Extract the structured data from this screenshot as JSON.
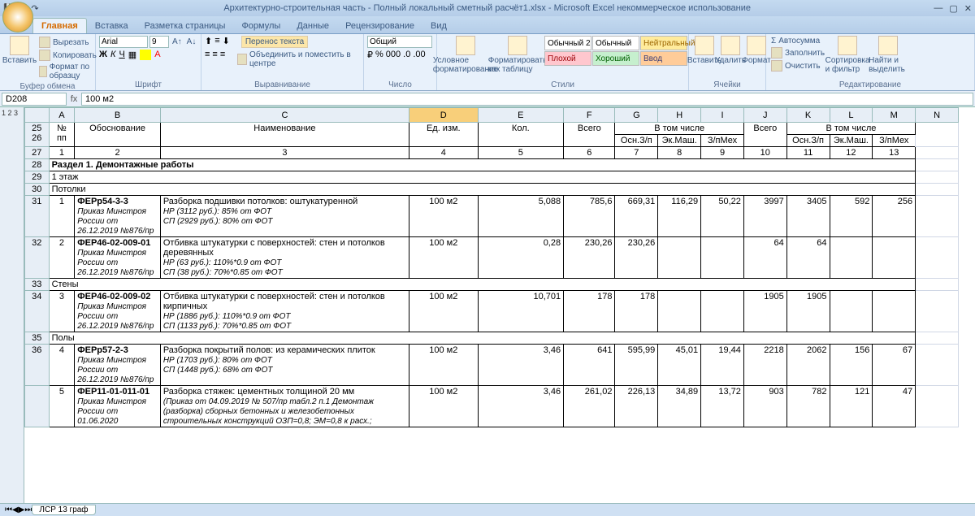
{
  "title": "Архитектурно-строительная часть - Полный локальный сметный расчёт1.xlsx - Microsoft Excel некоммерческое использование",
  "tabs": [
    "Главная",
    "Вставка",
    "Разметка страницы",
    "Формулы",
    "Данные",
    "Рецензирование",
    "Вид"
  ],
  "ribbon": {
    "clipboard": {
      "paste": "Вставить",
      "cut": "Вырезать",
      "copy": "Копировать",
      "fmt": "Формат по образцу",
      "label": "Буфер обмена"
    },
    "font": {
      "name": "Arial",
      "size": "9",
      "label": "Шрифт"
    },
    "align": {
      "wrap": "Перенос текста",
      "merge": "Объединить и поместить в центре",
      "label": "Выравнивание"
    },
    "number": {
      "fmt": "Общий",
      "label": "Число"
    },
    "styles": {
      "cond": "Условное форматирование",
      "table": "Форматировать как таблицу",
      "s1": "Обычный 2",
      "s2": "Обычный",
      "s3": "Нейтральный",
      "s4": "Плохой",
      "s5": "Хороший",
      "s6": "Ввод",
      "label": "Стили"
    },
    "cells": {
      "ins": "Вставить",
      "del": "Удалить",
      "fmt": "Формат",
      "label": "Ячейки"
    },
    "edit": {
      "sum": "Автосумма",
      "fill": "Заполнить",
      "clear": "Очистить",
      "sort": "Сортировка и фильтр",
      "find": "Найти и выделить",
      "label": "Редактирование"
    }
  },
  "namebox": "D208",
  "formula": "100 м2",
  "cols": [
    "A",
    "B",
    "C",
    "D",
    "E",
    "F",
    "G",
    "H",
    "I",
    "J",
    "K",
    "L",
    "M",
    "N"
  ],
  "header": {
    "npp": "№ пп",
    "osn": "Обоснование",
    "naim": "Наименование",
    "ed": "Ед. изм.",
    "kol": "Кол.",
    "vsego": "Всего",
    "vtom": "В том числе",
    "osn3": "Осн.З/п",
    "ekm": "Эк.Маш.",
    "zpm": "З/пМех"
  },
  "numrow": [
    "1",
    "2",
    "3",
    "4",
    "5",
    "6",
    "7",
    "8",
    "9",
    "10",
    "11",
    "12",
    "13"
  ],
  "section1": "Раздел 1. Демонтажные работы",
  "sub1": "1 этаж",
  "sub2": "Потолки",
  "sub3": "Стены",
  "sub4": "Полы",
  "rows": [
    {
      "n": "1",
      "code": "ФЕРр54-3-3",
      "src": "Приказ Минстроя России от 26.12.2019 №876/пр",
      "name": "Разборка подшивки потолков: оштукатуренной",
      "sub": "НР (3112 руб.): 85% от ФОТ\nСП (2929 руб.): 80% от ФОТ",
      "ed": "100 м2",
      "kol": "5,088",
      "v1": "785,6",
      "o1": "669,31",
      "e1": "116,29",
      "z1": "50,22",
      "v2": "3997",
      "o2": "3405",
      "e2": "592",
      "z2": "256"
    },
    {
      "n": "2",
      "code": "ФЕР46-02-009-01",
      "src": "Приказ Минстроя России от 26.12.2019 №876/пр",
      "name": "Отбивка штукатурки с поверхностей: стен и потолков деревянных",
      "sub": "НР (63 руб.): 110%*0.9 от ФОТ\nСП (38 руб.): 70%*0.85 от ФОТ",
      "ed": "100 м2",
      "kol": "0,28",
      "v1": "230,26",
      "o1": "230,26",
      "e1": "",
      "z1": "",
      "v2": "64",
      "o2": "64",
      "e2": "",
      "z2": ""
    },
    {
      "n": "3",
      "code": "ФЕР46-02-009-02",
      "src": "Приказ Минстроя России от 26.12.2019 №876/пр",
      "name": "Отбивка штукатурки с поверхностей: стен и потолков кирпичных",
      "sub": "НР (1886 руб.): 110%*0.9 от ФОТ\nСП (1133 руб.): 70%*0.85 от ФОТ",
      "ed": "100 м2",
      "kol": "10,701",
      "v1": "178",
      "o1": "178",
      "e1": "",
      "z1": "",
      "v2": "1905",
      "o2": "1905",
      "e2": "",
      "z2": ""
    },
    {
      "n": "4",
      "code": "ФЕРр57-2-3",
      "src": "Приказ Минстроя России от 26.12.2019 №876/пр",
      "name": "Разборка покрытий полов: из керамических плиток",
      "sub": "НР (1703 руб.): 80% от ФОТ\nСП (1448 руб.): 68% от ФОТ",
      "ed": "100 м2",
      "kol": "3,46",
      "v1": "641",
      "o1": "595,99",
      "e1": "45,01",
      "z1": "19,44",
      "v2": "2218",
      "o2": "2062",
      "e2": "156",
      "z2": "67"
    },
    {
      "n": "5",
      "code": "ФЕР11-01-011-01",
      "src": "Приказ Минстроя России от 01.06.2020",
      "name": "Разборка стяжек: цементных толщиной 20 мм",
      "sub": "(Приказ от 04.09.2019 № 507/пр табл.2 п.1 Демонтаж (разборка) сборных бетонных и железобетонных строительных конструкций ОЗП=0,8; ЭМ=0,8 к расх.;",
      "ed": "100 м2",
      "kol": "3,46",
      "v1": "261,02",
      "o1": "226,13",
      "e1": "34,89",
      "z1": "13,72",
      "v2": "903",
      "o2": "782",
      "e2": "121",
      "z2": "47"
    }
  ],
  "sheettab": "ЛСР 13 граф",
  "outline": "1 2 3"
}
